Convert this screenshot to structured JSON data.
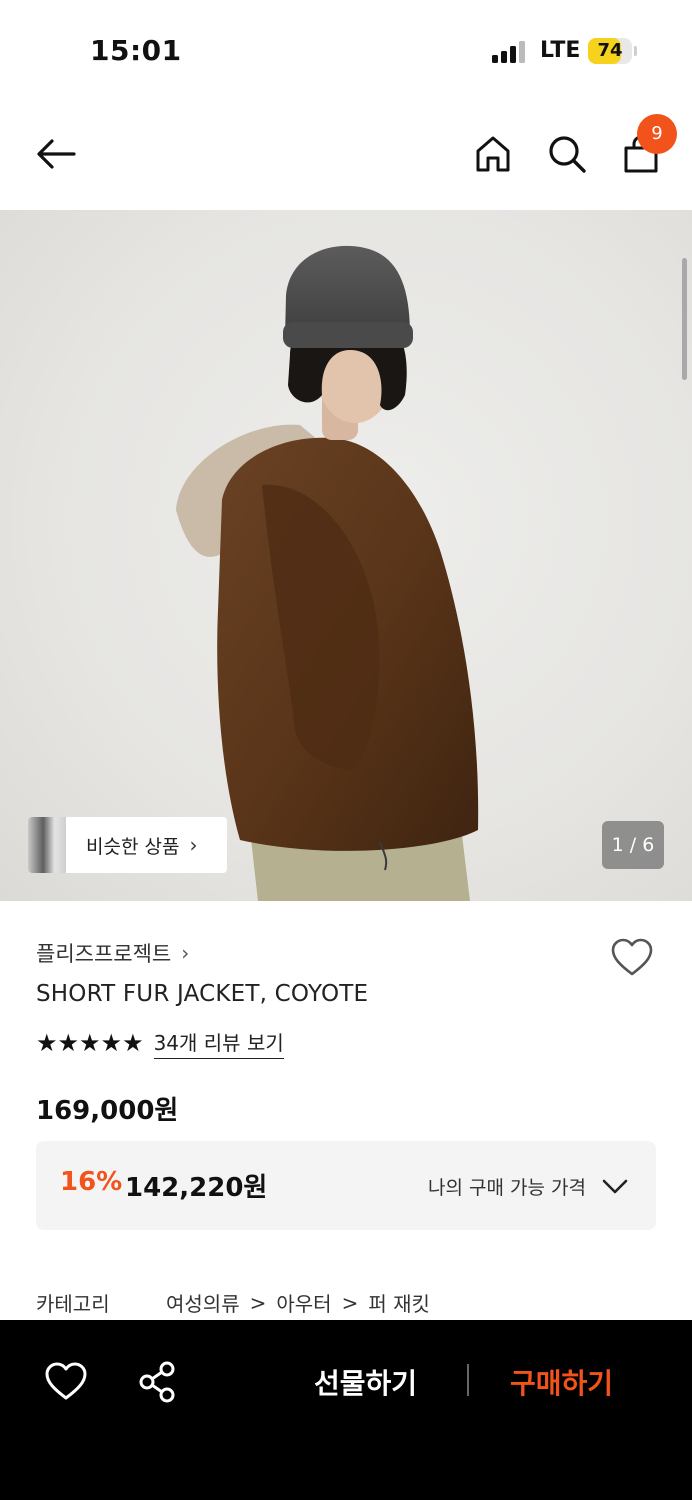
{
  "status_bar": {
    "time": "15:01",
    "network": "LTE",
    "battery": "74",
    "battery_level": 0.74
  },
  "nav": {
    "back_icon": "arrow-left-icon",
    "home_icon": "home-icon",
    "search_icon": "search-icon",
    "bag_icon": "shopping-bag-icon",
    "cart_count": "9"
  },
  "gallery": {
    "similar_label": "비슷한 상품",
    "similar_arrow": "›",
    "page_counter": "1 / 6"
  },
  "product": {
    "brand": "플리즈프로젝트",
    "brand_arrow": "›",
    "name": "SHORT FUR JACKET, COYOTE",
    "stars": "★★★★★",
    "rating_stars_filled": 5,
    "review_link": "34개 리뷰 보기",
    "original_price": "169,000원",
    "discount_rate": "16%",
    "sale_price": "142,220원",
    "my_price_label": "나의 구매 가능 가격",
    "category_label": "카테고리",
    "category_path": [
      "여성의류",
      "아우터",
      "퍼 재킷"
    ],
    "category_sep": ">"
  },
  "bottom_bar": {
    "gift_label": "선물하기",
    "buy_label": "구매하기"
  },
  "colors": {
    "accent": "#f2531a",
    "bottom_bar_bg": "#000000",
    "price_box_bg": "#f4f4f4"
  }
}
